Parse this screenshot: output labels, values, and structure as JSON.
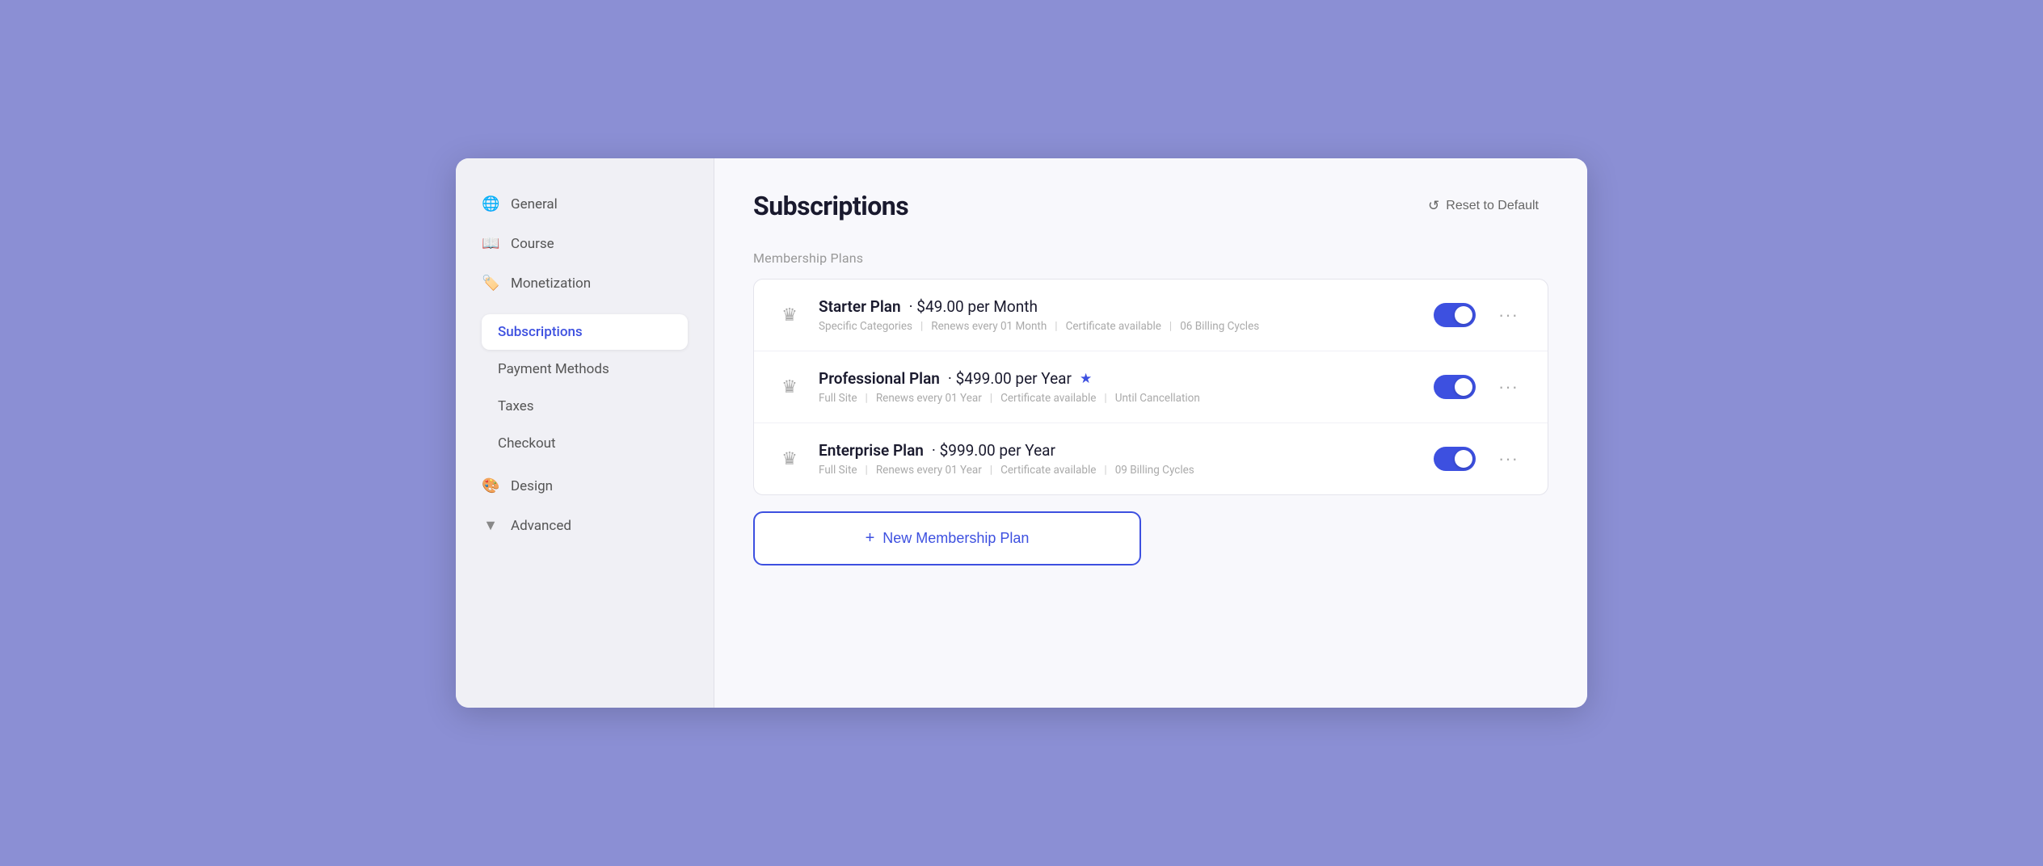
{
  "sidebar": {
    "items": [
      {
        "id": "general",
        "label": "General",
        "icon": "🌐"
      },
      {
        "id": "course",
        "label": "Course",
        "icon": "📖"
      },
      {
        "id": "monetization",
        "label": "Monetization",
        "icon": "🏷️"
      }
    ],
    "sub_items": [
      {
        "id": "subscriptions",
        "label": "Subscriptions",
        "active": true
      },
      {
        "id": "payment-methods",
        "label": "Payment Methods",
        "active": false
      },
      {
        "id": "taxes",
        "label": "Taxes",
        "active": false
      },
      {
        "id": "checkout",
        "label": "Checkout",
        "active": false
      }
    ],
    "bottom_items": [
      {
        "id": "design",
        "label": "Design",
        "icon": "🎨"
      },
      {
        "id": "advanced",
        "label": "Advanced",
        "icon": "🔻"
      }
    ]
  },
  "main": {
    "title": "Subscriptions",
    "reset_button": "Reset to Default",
    "section_label": "Membership Plans",
    "plans": [
      {
        "id": "starter",
        "name": "Starter Plan",
        "price": "$49.00 per Month",
        "featured": false,
        "details": [
          "Specific Categories",
          "Renews every 01 Month",
          "Certificate available",
          "06 Billing Cycles"
        ],
        "enabled": true
      },
      {
        "id": "professional",
        "name": "Professional Plan",
        "price": "$499.00 per Year",
        "featured": true,
        "details": [
          "Full Site",
          "Renews every 01 Year",
          "Certificate available",
          "Until Cancellation"
        ],
        "enabled": true
      },
      {
        "id": "enterprise",
        "name": "Enterprise Plan",
        "price": "$999.00 per Year",
        "featured": false,
        "details": [
          "Full Site",
          "Renews every 01 Year",
          "Certificate available",
          "09 Billing Cycles"
        ],
        "enabled": true
      }
    ],
    "new_plan_button": "+ New Membership Plan"
  },
  "icons": {
    "reset": "↺",
    "globe": "🌐",
    "book": "📖",
    "tag": "🏷️",
    "crown": "♛",
    "star": "★",
    "design": "🎨",
    "filter": "▼",
    "dots": "···",
    "plus": "+"
  }
}
